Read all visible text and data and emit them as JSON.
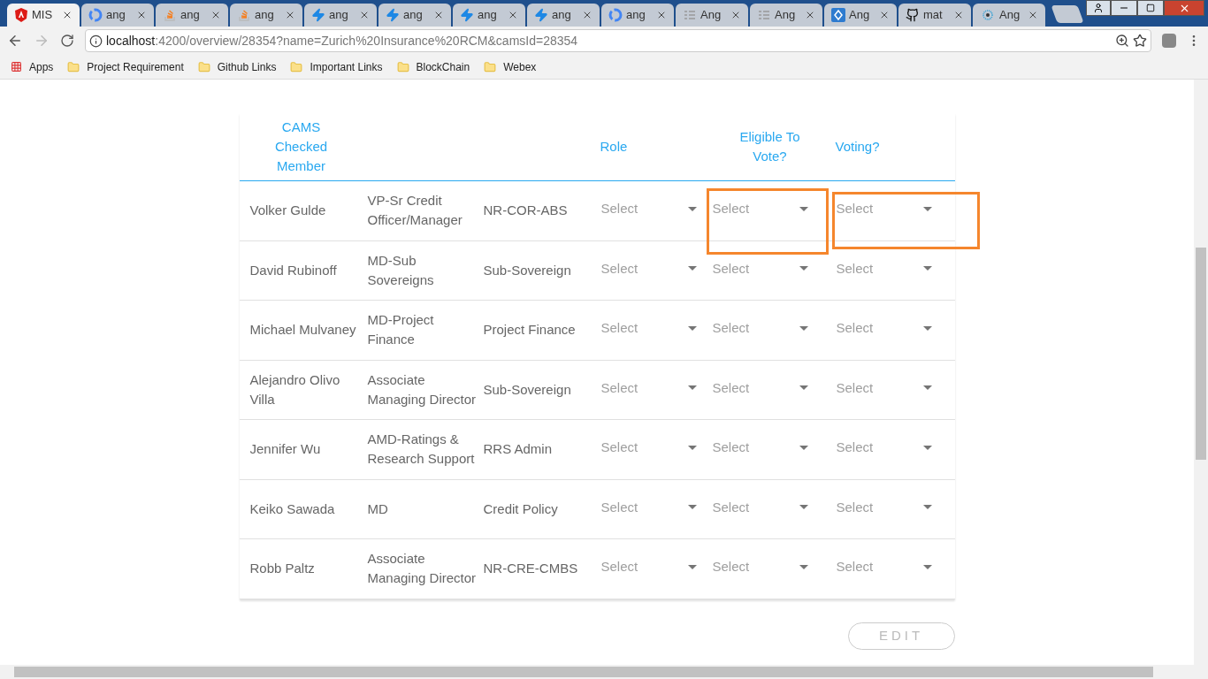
{
  "tabs": [
    {
      "label": "MIS",
      "kind": "angular",
      "selected": true
    },
    {
      "label": "ang",
      "kind": "google",
      "selected": false
    },
    {
      "label": "ang",
      "kind": "stack",
      "selected": false
    },
    {
      "label": "ang",
      "kind": "stack",
      "selected": false
    },
    {
      "label": "ang",
      "kind": "bolt",
      "selected": false
    },
    {
      "label": "ang",
      "kind": "bolt",
      "selected": false
    },
    {
      "label": "ang",
      "kind": "bolt",
      "selected": false
    },
    {
      "label": "ang",
      "kind": "bolt",
      "selected": false
    },
    {
      "label": "ang",
      "kind": "google",
      "selected": false
    },
    {
      "label": "Ang",
      "kind": "lines",
      "selected": false
    },
    {
      "label": "Ang",
      "kind": "lines",
      "selected": false
    },
    {
      "label": "Ang",
      "kind": "diamond",
      "selected": false
    },
    {
      "label": "mat",
      "kind": "github",
      "selected": false
    },
    {
      "label": "Ang",
      "kind": "cb",
      "selected": false
    }
  ],
  "address": {
    "host": "localhost",
    "path": ":4200/overview/28354?name=Zurich%20Insurance%20RCM&camsId=28354"
  },
  "bookmarks": [
    {
      "label": "Apps",
      "kind": "apps"
    },
    {
      "label": "Project Requirement",
      "kind": "folder"
    },
    {
      "label": "Github Links",
      "kind": "folder"
    },
    {
      "label": "Important Links",
      "kind": "folder"
    },
    {
      "label": "BlockChain",
      "kind": "folder"
    },
    {
      "label": "Webex",
      "kind": "folder"
    }
  ],
  "table": {
    "columns": [
      "CAMS Checked Member",
      "",
      "",
      "Role",
      "Eligible To Vote?",
      "Voting?"
    ],
    "rows": [
      {
        "name": "Volker Gulde",
        "title": "VP-Sr Credit Officer/Manager",
        "department": "NR-COR-ABS",
        "selects": [
          {
            "placeholder": "Select",
            "highlighted": false
          },
          {
            "placeholder": "Select",
            "highlighted": true
          },
          {
            "placeholder": "Select",
            "highlighted": true
          }
        ]
      },
      {
        "name": "David Rubinoff",
        "title": "MD-Sub Sovereigns",
        "department": "Sub-Sovereign",
        "selects": [
          {
            "placeholder": "Select",
            "highlighted": false
          },
          {
            "placeholder": "Select",
            "highlighted": false
          },
          {
            "placeholder": "Select",
            "highlighted": false
          }
        ]
      },
      {
        "name": "Michael Mulvaney",
        "title": "MD-Project Finance",
        "department": "Project Finance",
        "selects": [
          {
            "placeholder": "Select",
            "highlighted": false
          },
          {
            "placeholder": "Select",
            "highlighted": false
          },
          {
            "placeholder": "Select",
            "highlighted": false
          }
        ]
      },
      {
        "name": "Alejandro Olivo Villa",
        "title": "Associate Managing Director",
        "department": "Sub-Sovereign",
        "selects": [
          {
            "placeholder": "Select",
            "highlighted": false
          },
          {
            "placeholder": "Select",
            "highlighted": false
          },
          {
            "placeholder": "Select",
            "highlighted": false
          }
        ]
      },
      {
        "name": "Jennifer Wu",
        "title": "AMD-Ratings & Research Support",
        "department": "RRS Admin",
        "selects": [
          {
            "placeholder": "Select",
            "highlighted": false
          },
          {
            "placeholder": "Select",
            "highlighted": false
          },
          {
            "placeholder": "Select",
            "highlighted": false
          }
        ]
      },
      {
        "name": "Keiko Sawada",
        "title": "MD",
        "department": "Credit Policy",
        "selects": [
          {
            "placeholder": "Select",
            "highlighted": false
          },
          {
            "placeholder": "Select",
            "highlighted": false
          },
          {
            "placeholder": "Select",
            "highlighted": false
          }
        ]
      },
      {
        "name": "Robb Paltz",
        "title": "Associate Managing Director",
        "department": "NR-CRE-CMBS",
        "selects": [
          {
            "placeholder": "Select",
            "highlighted": false
          },
          {
            "placeholder": "Select",
            "highlighted": false
          },
          {
            "placeholder": "Select",
            "highlighted": false
          }
        ]
      }
    ]
  },
  "edit_button": {
    "label": "EDIT",
    "disabled": true
  }
}
